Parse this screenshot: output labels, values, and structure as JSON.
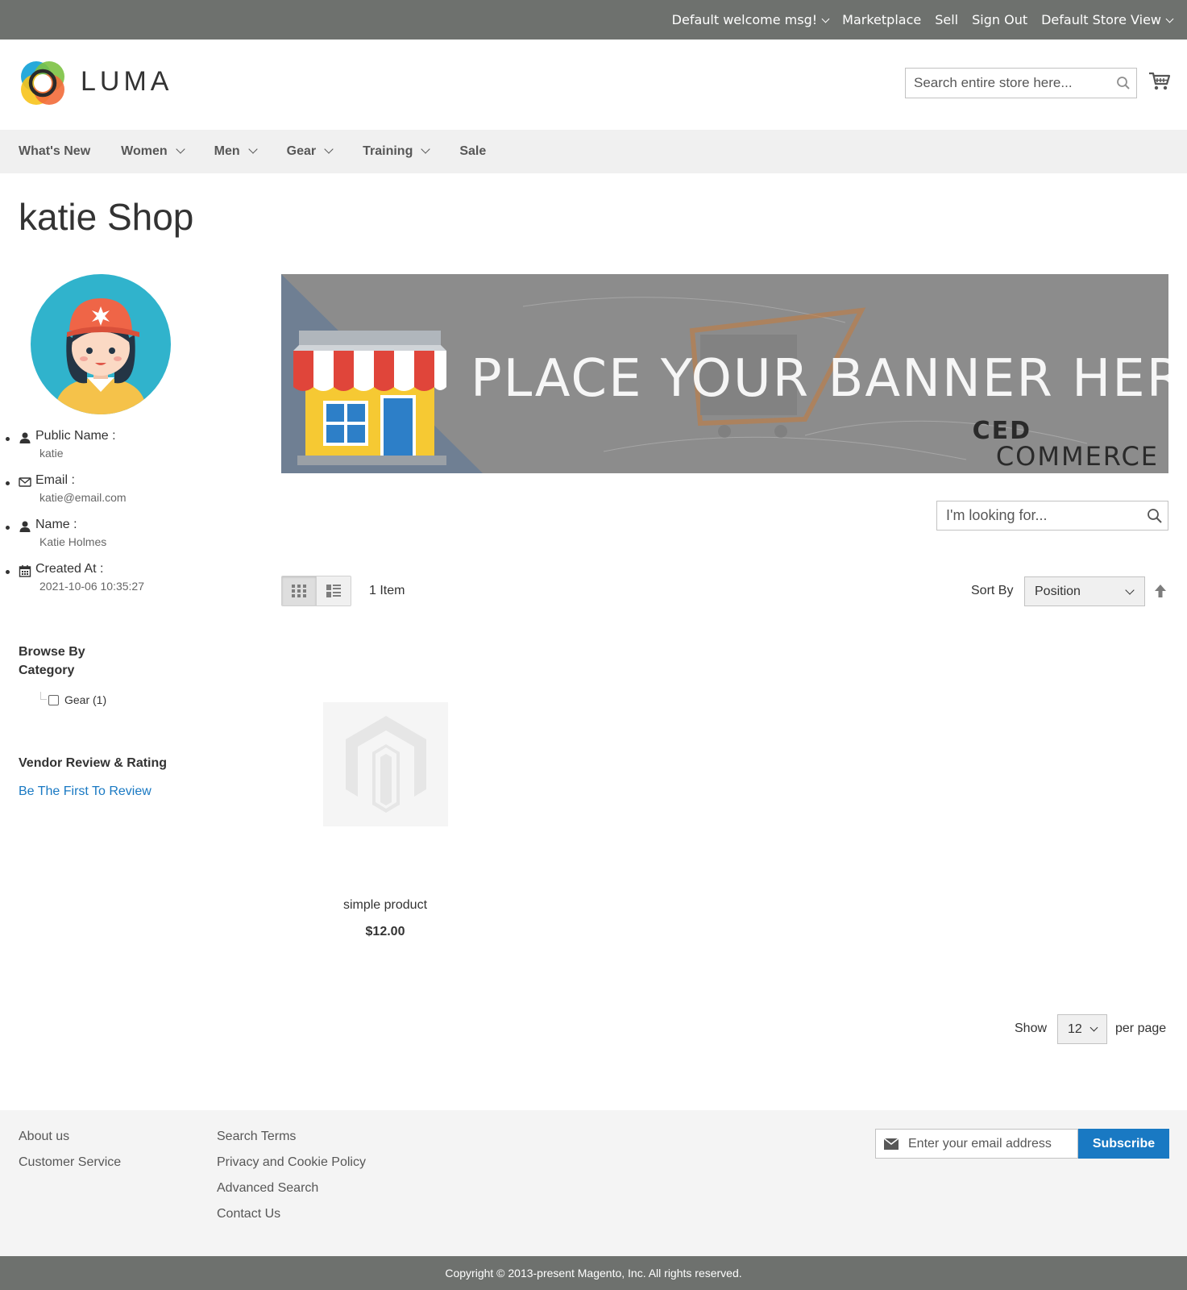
{
  "topbar": {
    "welcome": "Default welcome msg!",
    "marketplace": "Marketplace",
    "sell": "Sell",
    "sign_out": "Sign Out",
    "store_view": "Default Store View"
  },
  "header": {
    "logo_text": "LUMA",
    "search_placeholder": "Search entire store here...",
    "icons": [
      "search-icon",
      "cart-icon"
    ]
  },
  "nav": {
    "items": [
      {
        "label": "What's New",
        "dropdown": false
      },
      {
        "label": "Women",
        "dropdown": true
      },
      {
        "label": "Men",
        "dropdown": true
      },
      {
        "label": "Gear",
        "dropdown": true
      },
      {
        "label": "Training",
        "dropdown": true
      },
      {
        "label": "Sale",
        "dropdown": false
      }
    ]
  },
  "page": {
    "title": "katie Shop"
  },
  "vendor": {
    "public_name_label": "Public Name :",
    "public_name": "katie",
    "email_label": "Email :",
    "email": "katie@email.com",
    "name_label": "Name :",
    "name": "Katie Holmes",
    "created_label": "Created At :",
    "created": "2021-10-06 10:35:27"
  },
  "browse": {
    "title": "Browse By Category",
    "categories": [
      {
        "label": "Gear (1)",
        "checked": false
      }
    ]
  },
  "review": {
    "title": "Vendor Review & Rating",
    "link": "Be The First To Review"
  },
  "banner": {
    "text": "PLACE YOUR BANNER HERE",
    "brand_line1": "CED",
    "brand_line2": "COMMERCE"
  },
  "shop_search": {
    "placeholder": "I'm looking for..."
  },
  "toolbar": {
    "view_modes": [
      "grid",
      "list"
    ],
    "active_mode": "grid",
    "item_count": "1 Item",
    "sort_label": "Sort By",
    "sort_value": "Position",
    "sort_direction": "ascending"
  },
  "products": [
    {
      "name": "simple product",
      "price": "$12.00"
    }
  ],
  "limiter": {
    "show_label": "Show",
    "value": "12",
    "per_page_label": "per page"
  },
  "footer": {
    "col1": [
      "About us",
      "Customer Service"
    ],
    "col2": [
      "Search Terms",
      "Privacy and Cookie Policy",
      "Advanced Search",
      "Contact Us"
    ],
    "newsletter_placeholder": "Enter your email address",
    "subscribe_label": "Subscribe",
    "copyright": "Copyright © 2013-present Magento, Inc. All rights reserved."
  },
  "colors": {
    "topbar_bg": "#6e716e",
    "nav_bg": "#f0f0f0",
    "link": "#1979c3",
    "footer_bg": "#f4f4f4"
  }
}
